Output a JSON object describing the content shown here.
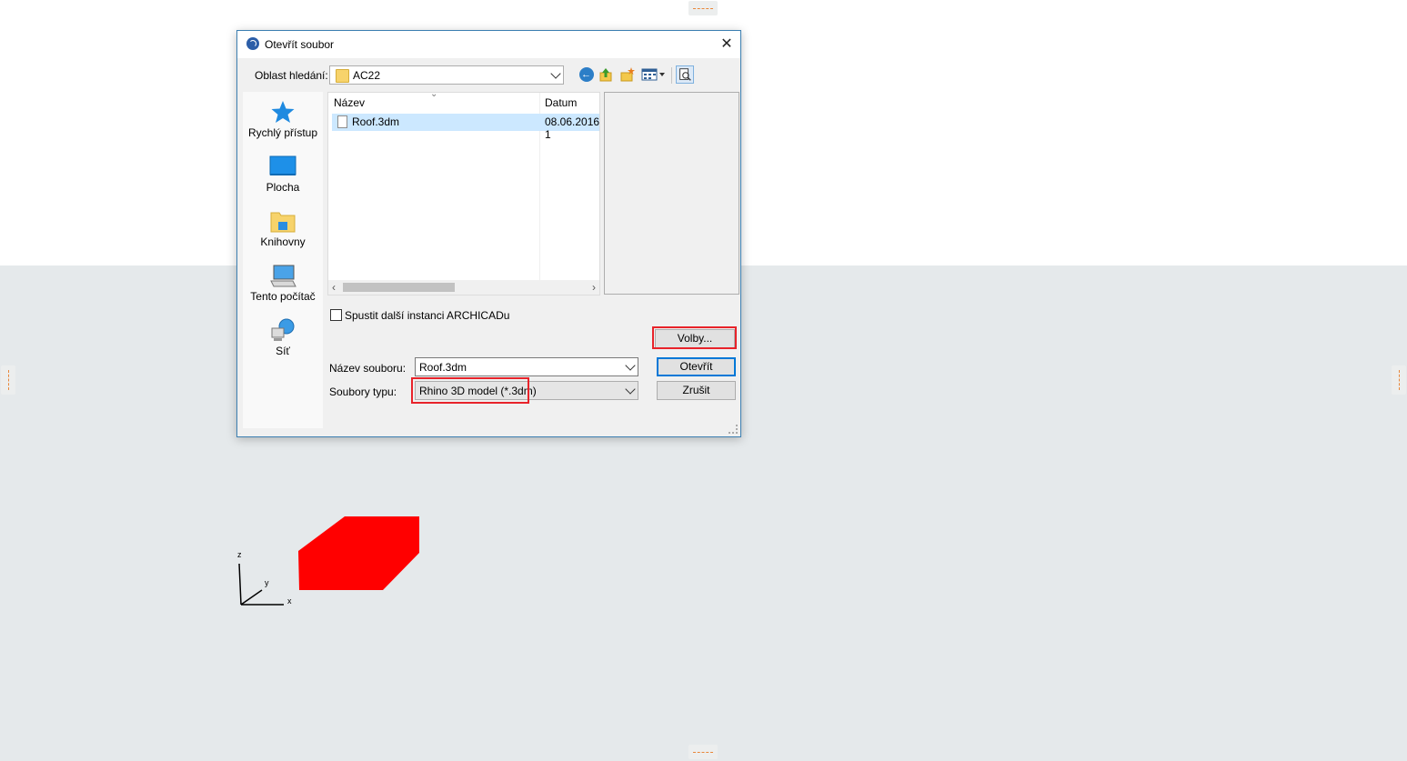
{
  "dialog": {
    "title": "Otevřít soubor",
    "look_in_label": "Oblast hledání:",
    "look_in_value": "AC22",
    "places": [
      {
        "label": "Rychlý přístup",
        "icon": "star-icon"
      },
      {
        "label": "Plocha",
        "icon": "desktop-icon"
      },
      {
        "label": "Knihovny",
        "icon": "libraries-icon"
      },
      {
        "label": "Tento počítač",
        "icon": "computer-icon"
      },
      {
        "label": "Síť",
        "icon": "network-icon"
      }
    ],
    "file_list": {
      "columns": [
        "Název",
        "Datum"
      ],
      "rows": [
        {
          "name": "Roof.3dm",
          "date": "08.06.2016 1"
        }
      ]
    },
    "checkbox_label": "Spustit další instanci ARCHICADu",
    "options_button": "Volby...",
    "filename_label": "Název souboru:",
    "filename_value": "Roof.3dm",
    "filetype_label": "Soubory typu:",
    "filetype_value": "Rhino 3D model (*.3dm)",
    "open_button": "Otevřít",
    "cancel_button": "Zrušit"
  },
  "viewport": {
    "axis_labels": {
      "x": "x",
      "y": "y",
      "z": "z"
    },
    "shape_color": "#ff0000",
    "highlight_color": "#e8232a"
  }
}
